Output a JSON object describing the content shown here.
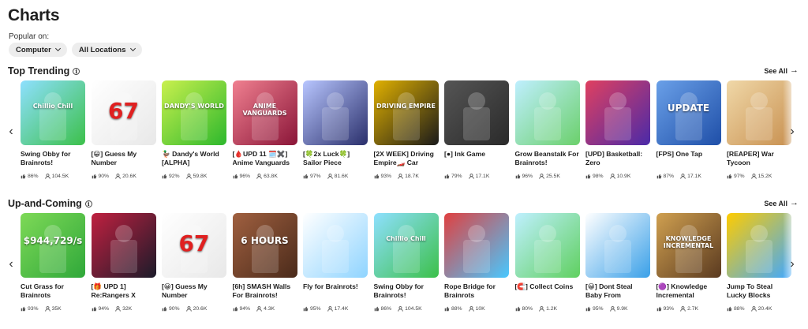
{
  "page": {
    "title": "Charts",
    "popular_on": "Popular on:"
  },
  "filters": [
    {
      "label": "Computer"
    },
    {
      "label": "All Locations"
    }
  ],
  "sections": [
    {
      "title": "Top Trending",
      "see_all": "See All",
      "games": [
        {
          "title": "Swing Obby for Brainrots!",
          "rating": "86%",
          "players": "104.5K",
          "bg": "#3cc04a",
          "bg2": "#8ee0ff",
          "art": "Chillio Chill"
        },
        {
          "title": "[😀] Guess My Number",
          "rating": "90%",
          "players": "20.6K",
          "bg": "#e8e8e8",
          "bg2": "#ffffff",
          "art": "67"
        },
        {
          "title": "🦆 Dandy's World [ALPHA]",
          "rating": "92%",
          "players": "59.8K",
          "bg": "#2db82d",
          "bg2": "#c9f04d",
          "art": "DANDY'S WORLD"
        },
        {
          "title": "[🩸UPD 11 🗓️✖️] Anime Vanguards",
          "rating": "96%",
          "players": "63.8K",
          "bg": "#8a1538",
          "bg2": "#f08090",
          "art": "ANIME VANGUARDS"
        },
        {
          "title": "[🍀2x Luck🍀] Sailor Piece",
          "rating": "97%",
          "players": "81.6K",
          "bg": "#2a2f6b",
          "bg2": "#b8c6ff",
          "art": ""
        },
        {
          "title": "[2X WEEK] Driving Empire🏎️ Car",
          "rating": "93%",
          "players": "18.7K",
          "bg": "#1a1a1a",
          "bg2": "#e0b000",
          "art": "DRIVING EMPIRE"
        },
        {
          "title": "[●] Ink Game",
          "rating": "79%",
          "players": "17.1K",
          "bg": "#2a2a2a",
          "bg2": "#555555",
          "art": ""
        },
        {
          "title": "Grow Beanstalk For Brainrots!",
          "rating": "96%",
          "players": "25.5K",
          "bg": "#6bd06b",
          "bg2": "#bfefff",
          "art": ""
        },
        {
          "title": "[UPD] Basketball: Zero",
          "rating": "98%",
          "players": "10.9K",
          "bg": "#4a2aa8",
          "bg2": "#e04060",
          "art": ""
        },
        {
          "title": "[FPS] One Tap",
          "rating": "87%",
          "players": "17.1K",
          "bg": "#1f4fa8",
          "bg2": "#6aa0e8",
          "art": "UPDATE"
        },
        {
          "title": "[REAPER] War Tycoon",
          "rating": "97%",
          "players": "15.2K",
          "bg": "#c89050",
          "bg2": "#f0d8a8",
          "art": ""
        }
      ]
    },
    {
      "title": "Up-and-Coming",
      "see_all": "See All",
      "games": [
        {
          "title": "Cut Grass for Brainrots",
          "rating": "93%",
          "players": "35K",
          "bg": "#2fa83a",
          "bg2": "#7ed957",
          "art": "$944,729/s"
        },
        {
          "title": "[🎁 UPD 1] Re:Rangers X",
          "rating": "94%",
          "players": "32K",
          "bg": "#1b1b2a",
          "bg2": "#c02040",
          "art": ""
        },
        {
          "title": "[😀] Guess My Number",
          "rating": "90%",
          "players": "20.6K",
          "bg": "#e8e8e8",
          "bg2": "#ffffff",
          "art": "67"
        },
        {
          "title": "[6h] SMASH Walls For Brainrots!",
          "rating": "94%",
          "players": "4.3K",
          "bg": "#4a2a1a",
          "bg2": "#a06040",
          "art": "6 HOURS"
        },
        {
          "title": "Fly for Brainrots!",
          "rating": "95%",
          "players": "17.4K",
          "bg": "#8fd4ff",
          "bg2": "#ffffff",
          "art": ""
        },
        {
          "title": "Swing Obby for Brainrots!",
          "rating": "86%",
          "players": "104.5K",
          "bg": "#3cc04a",
          "bg2": "#8ee0ff",
          "art": "Chillio Chill"
        },
        {
          "title": "Rope Bridge for Brainrots",
          "rating": "88%",
          "players": "10K",
          "bg": "#48c8ff",
          "bg2": "#e04040",
          "art": ""
        },
        {
          "title": "[🧲] Collect Coins",
          "rating": "80%",
          "players": "1.2K",
          "bg": "#5fd05f",
          "bg2": "#bff0ff",
          "art": ""
        },
        {
          "title": "[😀] Dont Steal Baby From",
          "rating": "95%",
          "players": "9.9K",
          "bg": "#3aa0e8",
          "bg2": "#ffffff",
          "art": ""
        },
        {
          "title": "[🟣] Knowledge Incremental",
          "rating": "93%",
          "players": "2.7K",
          "bg": "#5a3a20",
          "bg2": "#d0a050",
          "art": "KNOWLEDGE INCREMENTAL"
        },
        {
          "title": "Jump To Steal Lucky Blocks",
          "rating": "88%",
          "players": "20.4K",
          "bg": "#40a8ff",
          "bg2": "#ffcc00",
          "art": ""
        }
      ]
    }
  ]
}
